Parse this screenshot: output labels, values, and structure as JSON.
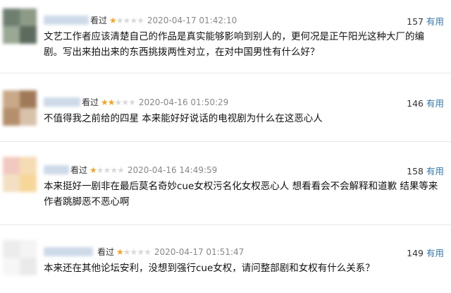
{
  "reviews": [
    {
      "watched": "看过",
      "rating": 1,
      "time": "2020-04-17 01:42:10",
      "votes": "157",
      "useful": "有用",
      "text": "文艺工作者应该清楚自己的作品是真实能够影响到别人的，更何况是正午阳光这种大厂的编剧。写出来拍出来的东西挑拨两性对立，在对中国男性有什么好？"
    },
    {
      "watched": "看过",
      "rating": 2,
      "time": "2020-04-16 01:50:29",
      "votes": "146",
      "useful": "有用",
      "text": "不值得我之前给的四星 本来能好好说话的电视剧为什么在这恶心人"
    },
    {
      "watched": "看过",
      "rating": 1,
      "time": "2020-04-16 14:49:59",
      "votes": "158",
      "useful": "有用",
      "text": "本来挺好一剧非在最后莫名奇妙cue女权污名化女权恶心人 想看看会不会解释和道歉 结果等来作者跳脚恶不恶心啊"
    },
    {
      "watched": "看过",
      "rating": 1,
      "time": "2020-04-17 01:51:47",
      "votes": "149",
      "useful": "有用",
      "text": "本来还在其他论坛安利，没想到强行cue女权，请问整部剧和女权有什么关系？"
    }
  ],
  "colors": {
    "star_on": "#f4a523",
    "star_off": "#d9d9d9",
    "link": "#3377aa"
  }
}
